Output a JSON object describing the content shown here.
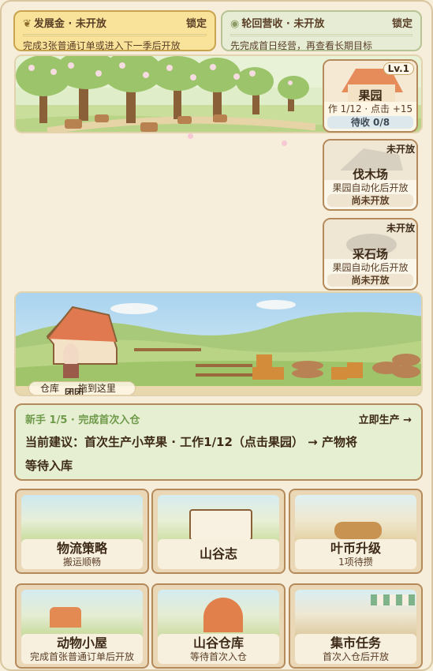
{
  "top_cards": [
    {
      "title": "发展金 · 未开放",
      "status": "锁定",
      "desc": "完成3张普通订单或进入下一季后开放",
      "icon": "seedling-icon"
    },
    {
      "title": "轮回营收 · 未开放",
      "status": "锁定",
      "desc": "先完成首日经营，再查看长期目标",
      "icon": "coin-icon"
    }
  ],
  "orchard_card": {
    "level": "Lv.1",
    "title": "果园",
    "sub": "作 1/12 · 点击 +15",
    "foot": "待收 0/8"
  },
  "lumber_card": {
    "tag": "未开放",
    "title": "伐木场",
    "sub": "果园自动化后开放",
    "foot": "尚未开放"
  },
  "quarry_card": {
    "tag": "未开放",
    "title": "采石场",
    "sub": "果园自动化后开放",
    "foot": "尚未开放"
  },
  "field_scene": {
    "warehouse_label": "仓库",
    "drag_hint": "拖到这里",
    "character_label": "团团"
  },
  "tutorial": {
    "step": "新手 1/5 · 完成首次入仓",
    "action": "立即生产 →",
    "line1": "当前建议：首次生产小苹果 · 工作1/12（点击果园） → 产物将",
    "line2": "等待入库"
  },
  "tiles": [
    {
      "title": "物流策略",
      "sub": "搬运顺畅"
    },
    {
      "title": "山谷志",
      "sub": ""
    },
    {
      "title": "叶币升级",
      "sub": "1项待攒"
    },
    {
      "title": "动物小屋",
      "sub": "完成首张普通订单后开放"
    },
    {
      "title": "山谷仓库",
      "sub": "等待首次入仓"
    },
    {
      "title": "集市任务",
      "sub": "首次入仓后开放"
    }
  ],
  "colors": {
    "accent_gold": "#f7dc86",
    "accent_green": "#e4edcf",
    "border": "#b48a5b"
  }
}
